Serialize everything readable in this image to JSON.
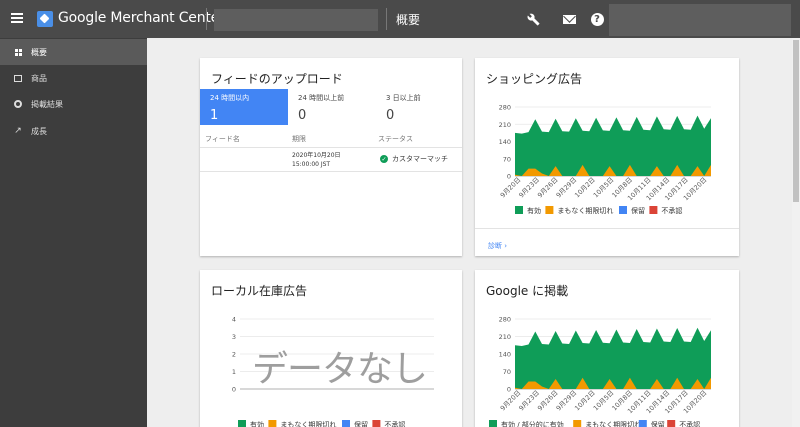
{
  "header": {
    "app_title": "Google Merchant Center",
    "page_heading": "概要",
    "icons": [
      "menu-icon",
      "merchant-logo-icon",
      "wrench-icon",
      "mail-icon",
      "help-icon"
    ],
    "help_glyph": "?"
  },
  "sidebar": {
    "items": [
      {
        "label": "概要",
        "icon": "dashboard-icon",
        "active": true
      },
      {
        "label": "商品",
        "icon": "list-icon",
        "active": false
      },
      {
        "label": "掲載結果",
        "icon": "ring-icon",
        "active": false
      },
      {
        "label": "成長",
        "icon": "trending-icon",
        "active": false
      }
    ]
  },
  "feed_card": {
    "title": "フィードのアップロード",
    "tabs": [
      {
        "label": "24 時間以内",
        "count": "1"
      },
      {
        "label": "24 時間以上前",
        "count": "0"
      },
      {
        "label": "3 日以上前",
        "count": "0"
      }
    ],
    "columns": [
      "フィード名",
      "期限",
      "ステータス"
    ],
    "row": {
      "date": "2020年10月20日",
      "time": "15:00:00 JST",
      "status": "カスタマーマッチ"
    }
  },
  "shopping_card": {
    "title": "ショッピング広告",
    "link": "診断",
    "legend": [
      "有効",
      "まもなく期限切れ",
      "保留",
      "不承認"
    ]
  },
  "local_card": {
    "title": "ローカル在庫広告",
    "no_data": "データなし",
    "legend": [
      "有効",
      "まもなく期限切れ",
      "保留",
      "不承認"
    ]
  },
  "google_card": {
    "title": "Google に掲載",
    "legend": [
      "有効 / 部分的に有効",
      "まもなく期限切れ",
      "保留",
      "不承認"
    ]
  },
  "colors": {
    "active": "#0f9d58",
    "expiring": "#f29900",
    "pending": "#4285f4",
    "disapproved": "#db4437",
    "partial": "#137333"
  },
  "chart_data": [
    {
      "type": "area",
      "title": "ショッピング広告",
      "y_ticks": [
        "0",
        "70",
        "140",
        "210",
        "280"
      ],
      "ylim": [
        0,
        280
      ],
      "x": [
        "9月20日",
        "9月23日",
        "9月26日",
        "9月29日",
        "10月2日",
        "10月5日",
        "10月8日",
        "10月11日",
        "10月14日",
        "10月17日",
        "10月20日"
      ],
      "series": [
        {
          "name": "有効",
          "values": [
            175,
            172,
            178,
            230,
            180,
            178,
            232,
            182,
            180,
            234,
            184,
            182,
            236,
            185,
            183,
            238,
            186,
            184,
            240,
            188,
            186,
            242,
            190,
            188,
            244,
            190,
            188,
            245,
            192,
            235
          ]
        },
        {
          "name": "まもなく期限切れ",
          "values": [
            5,
            0,
            30,
            30,
            10,
            0,
            40,
            0,
            0,
            0,
            45,
            0,
            0,
            0,
            40,
            0,
            0,
            45,
            0,
            0,
            0,
            40,
            0,
            0,
            45,
            0,
            0,
            40,
            0,
            45
          ]
        }
      ],
      "legend": [
        "有効",
        "まもなく期限切れ",
        "保留",
        "不承認"
      ]
    },
    {
      "type": "area",
      "title": "ローカル在庫広告",
      "y_ticks": [
        "0",
        "1",
        "2",
        "3",
        "4"
      ],
      "ylim": [
        0,
        4
      ],
      "series": [],
      "legend": [
        "有効",
        "まもなく期限切れ",
        "保留",
        "不承認"
      ]
    },
    {
      "type": "area",
      "title": "Google に掲載",
      "y_ticks": [
        "0",
        "70",
        "140",
        "210",
        "280"
      ],
      "ylim": [
        0,
        280
      ],
      "x": [
        "9月20日",
        "9月23日",
        "9月26日",
        "9月29日",
        "10月2日",
        "10月5日",
        "10月8日",
        "10月11日",
        "10月14日",
        "10月17日",
        "10月20日"
      ],
      "series": [
        {
          "name": "有効 / 部分的に有効",
          "values": [
            175,
            172,
            178,
            230,
            180,
            178,
            232,
            182,
            180,
            234,
            184,
            182,
            236,
            185,
            183,
            238,
            186,
            184,
            240,
            188,
            186,
            242,
            190,
            188,
            244,
            190,
            188,
            245,
            192,
            235
          ]
        },
        {
          "name": "まもなく期限切れ",
          "values": [
            5,
            0,
            30,
            30,
            10,
            0,
            40,
            0,
            0,
            0,
            45,
            0,
            0,
            0,
            40,
            0,
            0,
            45,
            0,
            0,
            0,
            40,
            0,
            0,
            45,
            0,
            0,
            40,
            0,
            45
          ]
        }
      ],
      "legend": [
        "有効 / 部分的に有効",
        "まもなく期限切れ",
        "保留",
        "不承認"
      ]
    }
  ]
}
